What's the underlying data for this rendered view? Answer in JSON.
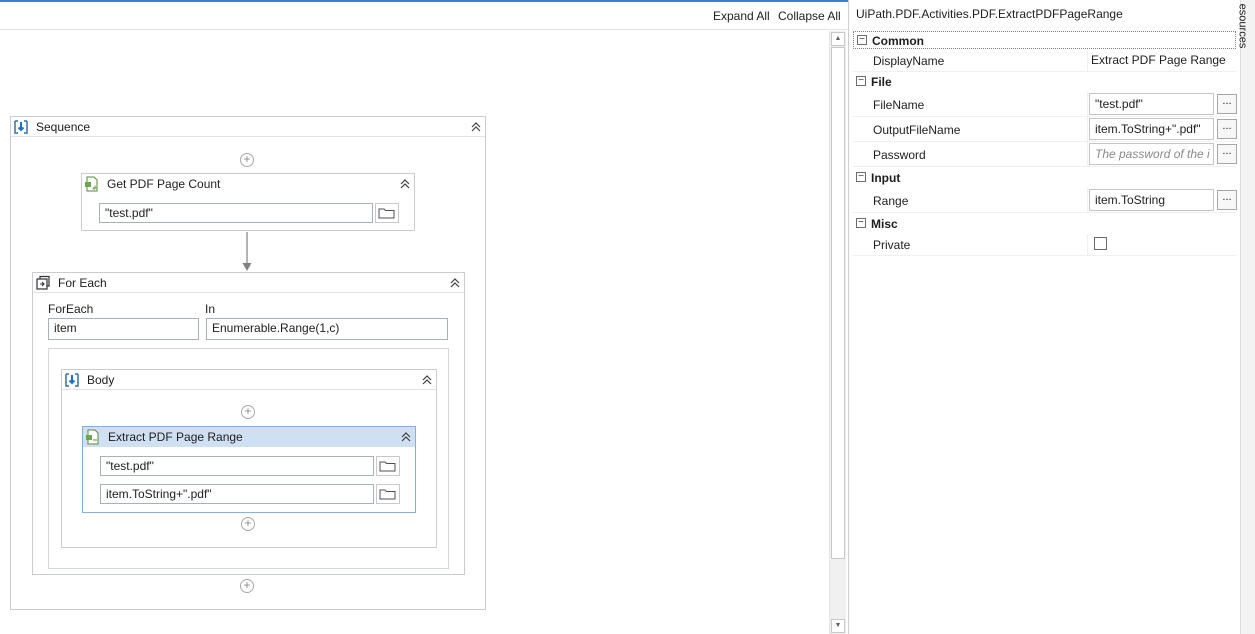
{
  "toolbar": {
    "expand_all": "Expand All",
    "collapse_all": "Collapse All"
  },
  "workflow": {
    "sequence": {
      "title": "Sequence"
    },
    "get_pdf_page_count": {
      "title": "Get PDF Page Count",
      "file_value": "\"test.pdf\""
    },
    "for_each": {
      "title": "For Each",
      "foreach_label": "ForEach",
      "foreach_value": "item",
      "in_label": "In",
      "in_value": "Enumerable.Range(1,c)"
    },
    "body": {
      "title": "Body"
    },
    "extract_pdf_page_range": {
      "title": "Extract PDF Page Range",
      "file_value": "\"test.pdf\"",
      "output_value": "item.ToString+\".pdf\""
    }
  },
  "properties": {
    "title": "UiPath.PDF.Activities.PDF.ExtractPDFPageRange",
    "categories": {
      "common": "Common",
      "file": "File",
      "input": "Input",
      "misc": "Misc"
    },
    "display_name": {
      "label": "DisplayName",
      "value": "Extract PDF Page Range"
    },
    "file_name": {
      "label": "FileName",
      "value": "\"test.pdf\""
    },
    "output_file_name": {
      "label": "OutputFileName",
      "value": "item.ToString+\".pdf\""
    },
    "password": {
      "label": "Password",
      "placeholder": "The password of the i"
    },
    "range": {
      "label": "Range",
      "value": "item.ToString"
    },
    "private": {
      "label": "Private",
      "checked": false
    },
    "ellipsis": "...",
    "collapse_glyph": "−"
  },
  "side_tab": {
    "label": "esources"
  },
  "colors": {
    "accent": "#3b7fd1",
    "selected_header": "#cfe0f3"
  }
}
